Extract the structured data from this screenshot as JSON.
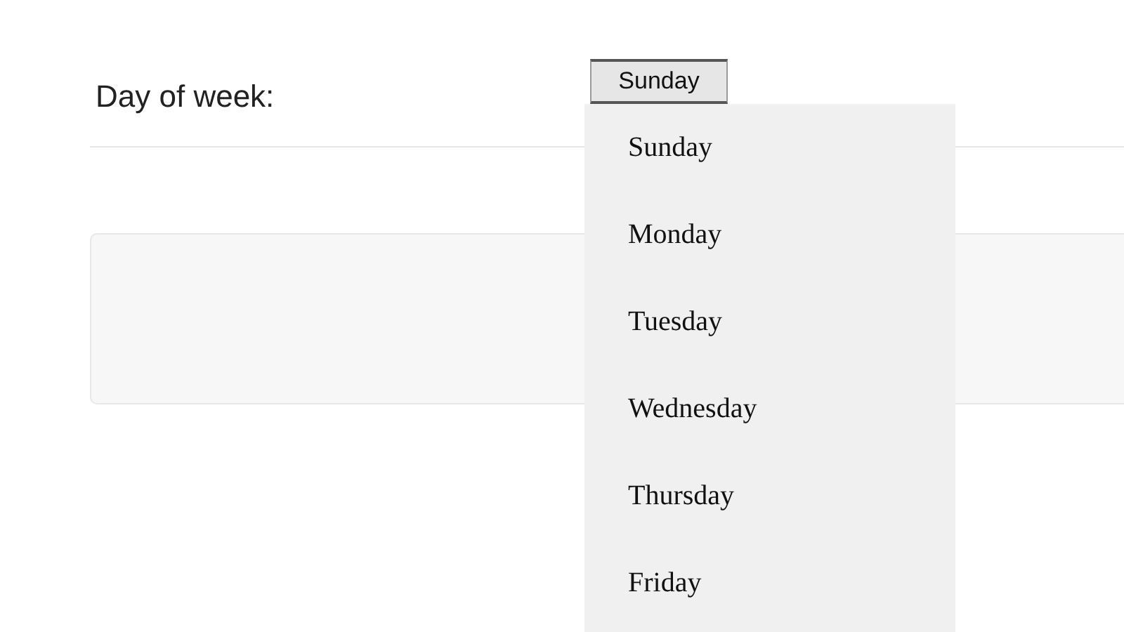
{
  "field": {
    "label": "Day of week:",
    "value": "Sunday"
  },
  "dropdown": {
    "options": [
      {
        "label": "Sunday"
      },
      {
        "label": "Monday"
      },
      {
        "label": "Tuesday"
      },
      {
        "label": "Wednesday"
      },
      {
        "label": "Thursday"
      },
      {
        "label": "Friday"
      }
    ]
  }
}
